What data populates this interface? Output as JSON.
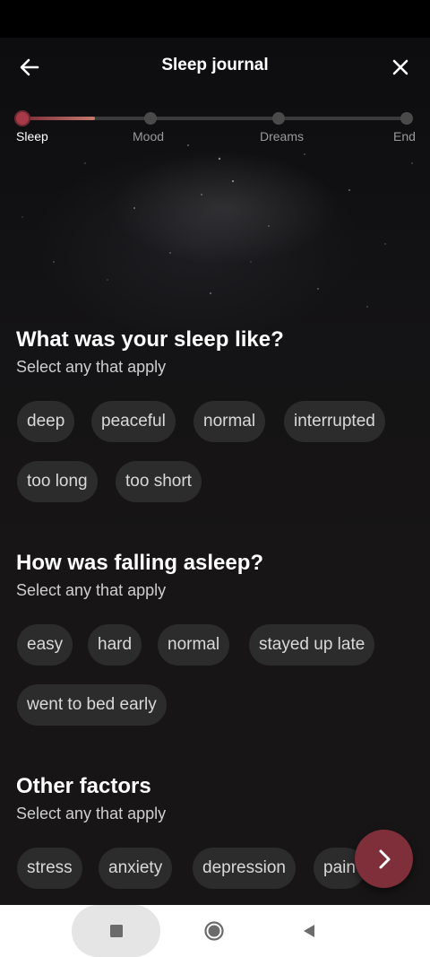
{
  "header": {
    "title": "Sleep journal",
    "back_icon": "arrow-left-icon",
    "close_icon": "close-icon"
  },
  "progress": {
    "current_step": 0,
    "fill_fraction": 0.19,
    "steps": [
      {
        "label": "Sleep"
      },
      {
        "label": "Mood"
      },
      {
        "label": "Dreams"
      },
      {
        "label": "End"
      }
    ]
  },
  "sections": [
    {
      "title": "What was your sleep like?",
      "subtitle": "Select any that apply",
      "chips": [
        "deep",
        "peaceful",
        "normal",
        "interrupted",
        "too long",
        "too short"
      ]
    },
    {
      "title": "How was falling asleep?",
      "subtitle": "Select any that apply",
      "chips": [
        "easy",
        "hard",
        "normal",
        "stayed up late",
        "went to bed early"
      ]
    },
    {
      "title": "Other factors",
      "subtitle": "Select any that apply",
      "chips": [
        "stress",
        "anxiety",
        "depression",
        "pain"
      ]
    }
  ],
  "fab": {
    "icon": "chevron-right-icon"
  },
  "navbar": {
    "recent_icon": "square-icon",
    "home_icon": "circle-icon",
    "back_icon": "triangle-back-icon"
  },
  "colors": {
    "background": "#161414",
    "chip": "#2d2c2c",
    "accent": "#7e2f3a",
    "active_dot": "#a83a48"
  }
}
